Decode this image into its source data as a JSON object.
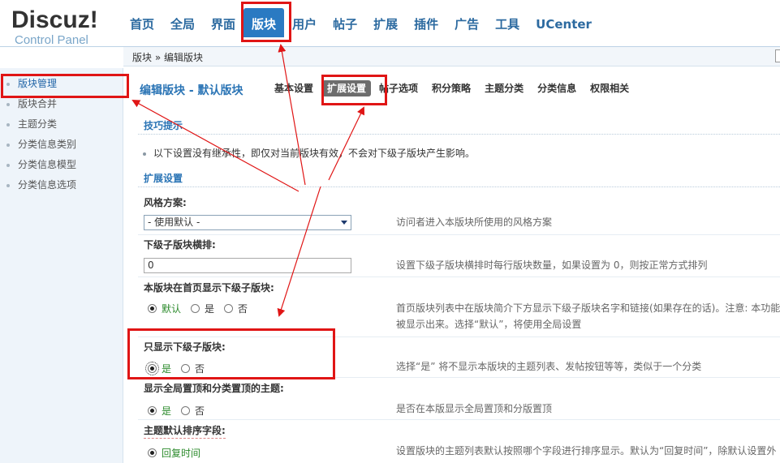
{
  "logo": {
    "brand": "Discuz!",
    "subtitle": "Control Panel"
  },
  "nav": [
    "首页",
    "全局",
    "界面",
    "版块",
    "用户",
    "帖子",
    "扩展",
    "插件",
    "广告",
    "工具",
    "UCenter"
  ],
  "nav_active": "版块",
  "breadcrumb": "版块 » 编辑版块",
  "sidebar": [
    "版块管理",
    "版块合并",
    "主题分类",
    "分类信息类别",
    "分类信息模型",
    "分类信息选项"
  ],
  "page_title": "编辑版块 - 默认版块",
  "tabs": [
    "基本设置",
    "扩展设置",
    "帖子选项",
    "积分策略",
    "主题分类",
    "分类信息",
    "权限相关"
  ],
  "tips": {
    "heading": "技巧提示",
    "text": "以下设置没有继承性，即仅对当前版块有效，不会对下级子版块产生影响。"
  },
  "ext_heading": "扩展设置",
  "fields": {
    "style": {
      "label": "风格方案:",
      "value": "- 使用默认 -",
      "note": "访问者进入本版块所使用的风格方案"
    },
    "sub_cols": {
      "label": "下级子版块横排:",
      "value": "0",
      "note": "设置下级子版块横排时每行版块数量，如果设置为 0，则按正常方式排列"
    },
    "show_sub": {
      "label": "本版块在首页显示下级子版块:",
      "options": [
        "默认",
        "是",
        "否"
      ],
      "selected": "默认",
      "note1": "首页版块列表中在版块简介下方显示下级子版块名字和链接(如果存在的话)。注意: 本功能",
      "note2": "被显示出来。选择“默认”，将使用全局设置"
    },
    "only_sub": {
      "label": "只显示下级子版块:",
      "options": [
        "是",
        "否"
      ],
      "selected": "是",
      "note": "选择“是”  将不显示本版块的主题列表、发帖按钮等等，类似于一个分类"
    },
    "global_top": {
      "label": "显示全局置顶和分类置顶的主题:",
      "options": [
        "是",
        "否"
      ],
      "selected": "是",
      "note": "是否在本版显示全局置顶和分版置顶"
    },
    "sort_field": {
      "label": "主题默认排序字段:",
      "options": [
        "回复时间"
      ],
      "selected": "回复时间",
      "note": "设置版块的主题列表默认按照哪个字段进行排序显示。默认为“回复时间”，除默认设置外"
    }
  },
  "colors": {
    "accent": "#2a7ac2",
    "annotation": "#e01515",
    "selected_text": "#2b8a2b"
  }
}
